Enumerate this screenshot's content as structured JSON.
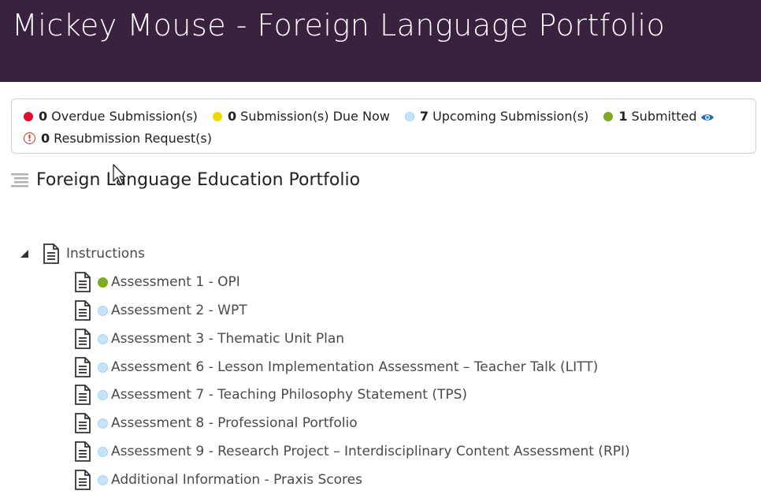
{
  "header": {
    "title": "Mickey Mouse - Foreign Language Portfolio"
  },
  "colors": {
    "header_bg": "#3b2140",
    "overdue": "#e0102f",
    "due_now": "#f2d600",
    "upcoming": "#c6e4f8",
    "submitted": "#7cab20",
    "resubmission": "#c0392b",
    "link": "#1f6fb5"
  },
  "status": {
    "overdue": {
      "count": "0",
      "label": "Overdue Submission(s)",
      "icon": "red-dot"
    },
    "due_now": {
      "count": "0",
      "label": "Submission(s) Due Now",
      "icon": "yellow-dot"
    },
    "upcoming": {
      "count": "7",
      "label": "Upcoming Submission(s)",
      "icon": "light-blue-dot"
    },
    "submitted": {
      "count": "1",
      "label": "Submitted",
      "icon": "green-dot",
      "link_icon": "eye-icon"
    },
    "resubmission": {
      "count": "0",
      "label": "Resubmission Request(s)",
      "icon": "exclamation-circle-icon"
    }
  },
  "section": {
    "title": "Foreign Language Education Portfolio",
    "icon": "lines-icon"
  },
  "tree": {
    "root": {
      "label": "Instructions",
      "icon": "document-icon",
      "expanded": true
    },
    "items": [
      {
        "label": "Assessment 1 - OPI",
        "status": "submitted"
      },
      {
        "label": "Assessment 2 - WPT",
        "status": "upcoming"
      },
      {
        "label": "Assessment 3 - Thematic Unit Plan",
        "status": "upcoming"
      },
      {
        "label": "Assessment 6 - Lesson Implementation Assessment – Teacher Talk (LITT)",
        "status": "upcoming"
      },
      {
        "label": "Assessment 7 - Teaching Philosophy Statement (TPS)",
        "status": "upcoming"
      },
      {
        "label": "Assessment 8 - Professional Portfolio",
        "status": "upcoming"
      },
      {
        "label": "Assessment 9 - Research Project – Interdisciplinary Content Assessment (RPI)",
        "status": "upcoming"
      },
      {
        "label": "Additional Information - Praxis Scores",
        "status": "upcoming"
      }
    ]
  }
}
